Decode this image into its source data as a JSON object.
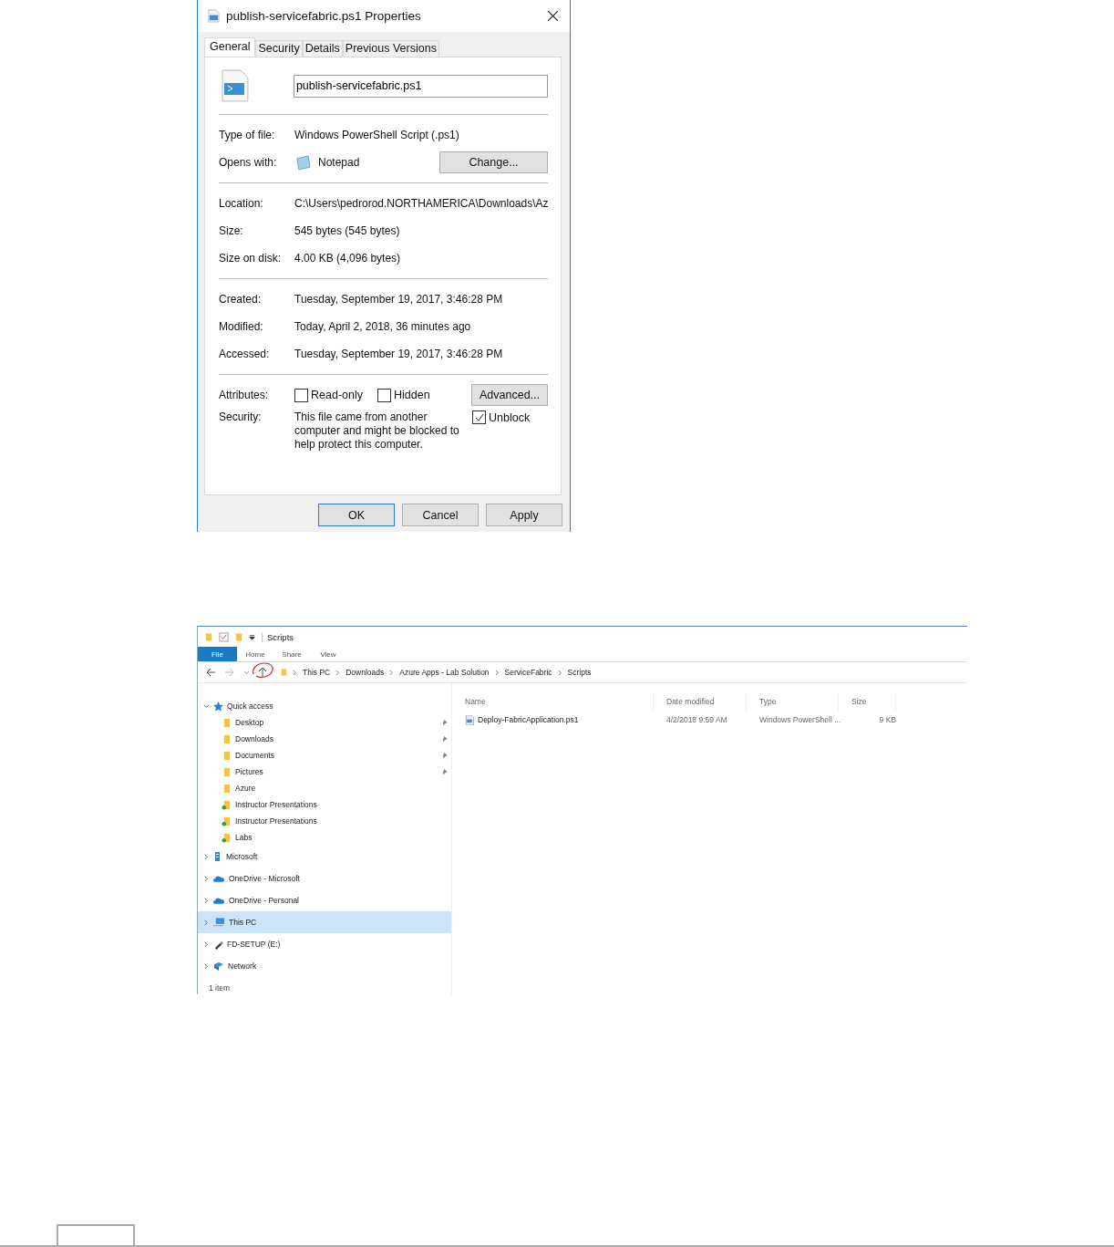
{
  "properties_dialog": {
    "title": "publish-servicefabric.ps1 Properties",
    "tabs": [
      {
        "label": "General",
        "selected": true
      },
      {
        "label": "Security",
        "selected": false
      },
      {
        "label": "Details",
        "selected": false
      },
      {
        "label": "Previous Versions",
        "selected": false
      }
    ],
    "file_name": "publish-servicefabric.ps1",
    "sections": [
      {
        "rows": [
          {
            "kind": "text",
            "label": "Type of file:",
            "value": "Windows PowerShell Script (.ps1)"
          },
          {
            "kind": "app",
            "label": "Opens with:",
            "value": "Notepad",
            "button": "Change..."
          }
        ]
      },
      {
        "rows": [
          {
            "kind": "text",
            "label": "Location:",
            "value": "C:\\Users\\pedrorod.NORTHAMERICA\\Downloads\\Az"
          },
          {
            "kind": "text",
            "label": "Size:",
            "value": "545 bytes (545 bytes)"
          },
          {
            "kind": "text",
            "label": "Size on disk:",
            "value": "4.00 KB (4,096 bytes)"
          }
        ]
      },
      {
        "rows": [
          {
            "kind": "text",
            "label": "Created:",
            "value": "Tuesday, September 19, 2017, 3:46:28 PM"
          },
          {
            "kind": "text",
            "label": "Modified:",
            "value": "Today, April 2, 2018, 36 minutes ago"
          },
          {
            "kind": "text",
            "label": "Accessed:",
            "value": "Tuesday, September 19, 2017, 3:46:28 PM"
          }
        ]
      },
      {
        "rows": [
          {
            "kind": "attributes",
            "label": "Attributes:",
            "checkboxes": [
              {
                "label": "Read-only",
                "checked": false
              },
              {
                "label": "Hidden",
                "checked": false
              }
            ],
            "button": "Advanced..."
          },
          {
            "kind": "security",
            "label": "Security:",
            "value": "This file came from another computer and might be blocked to help protect this computer.",
            "checkbox": {
              "label": "Unblock",
              "checked": true
            }
          }
        ]
      }
    ],
    "buttons": [
      {
        "label": "OK",
        "default": true
      },
      {
        "label": "Cancel",
        "default": false
      },
      {
        "label": "Apply",
        "default": false
      }
    ]
  },
  "explorer": {
    "title": "Scripts",
    "ribbon_tabs": [
      {
        "label": "File",
        "selected": true
      },
      {
        "label": "Home",
        "selected": false
      },
      {
        "label": "Share",
        "selected": false
      },
      {
        "label": "View",
        "selected": false
      }
    ],
    "breadcrumb": [
      "This PC",
      "Downloads",
      "Azure Apps - Lab Solution",
      "ServiceFabric",
      "Scripts"
    ],
    "nav": [
      {
        "label": "Quick access",
        "kind": "star",
        "expanded": true,
        "selected": false,
        "children": [
          {
            "label": "Desktop",
            "kind": "folder",
            "pinned": true
          },
          {
            "label": "Downloads",
            "kind": "folder",
            "pinned": true
          },
          {
            "label": "Documents",
            "kind": "folder",
            "pinned": true
          },
          {
            "label": "Pictures",
            "kind": "folder",
            "pinned": true
          },
          {
            "label": "Azure",
            "kind": "folder",
            "pinned": false
          },
          {
            "label": "Instructor Presentations",
            "kind": "synced",
            "pinned": false
          },
          {
            "label": "Instructor Presentations",
            "kind": "synced",
            "pinned": false
          },
          {
            "label": "Labs",
            "kind": "synced",
            "pinned": false
          }
        ]
      },
      {
        "label": "Microsoft",
        "kind": "building",
        "expanded": false,
        "selected": false
      },
      {
        "label": "OneDrive - Microsoft",
        "kind": "cloud",
        "expanded": false,
        "selected": false
      },
      {
        "label": "OneDrive - Personal",
        "kind": "cloud",
        "expanded": false,
        "selected": false
      },
      {
        "label": "This PC",
        "kind": "pc",
        "expanded": false,
        "selected": true
      },
      {
        "label": "FD-SETUP (E:)",
        "kind": "usb",
        "expanded": false,
        "selected": false
      },
      {
        "label": "Network",
        "kind": "network",
        "expanded": false,
        "selected": false
      }
    ],
    "columns": [
      "Name",
      "Date modified",
      "Type",
      "Size"
    ],
    "rows": [
      {
        "name": "Deploy-FabricApplication.ps1",
        "date_modified": "4/2/2018 9:59 AM",
        "type": "Windows PowerShell ...",
        "size": "9 KB"
      }
    ],
    "status_bar": "1 item"
  }
}
